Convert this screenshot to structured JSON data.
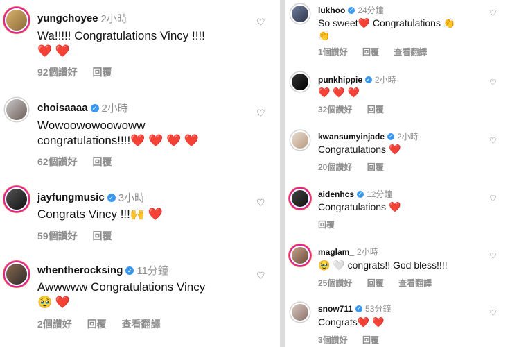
{
  "left_comments": [
    {
      "username": "yungchoyee",
      "time": "2小時",
      "lines": [
        "Wa!!!!! Congratulations Vincy !!!!",
        "❤️ ❤️"
      ],
      "likes": "92個讚好",
      "reply": "回覆",
      "translate": ""
    },
    {
      "username": "choisaaaa",
      "time": "2小時",
      "lines": [
        "Wowoowowoowoww",
        "congratulations!!!!❤️ ❤️ ❤️ ❤️"
      ],
      "likes": "62個讚好",
      "reply": "回覆",
      "translate": ""
    },
    {
      "username": "jayfungmusic",
      "time": "3小時",
      "lines": [
        "Congrats Vincy !!!🙌 ❤️"
      ],
      "likes": "59個讚好",
      "reply": "回覆",
      "translate": ""
    },
    {
      "username": "whentherocksing",
      "time": "11分鐘",
      "lines": [
        "Awwwww Congratulations Vincy",
        "🥹 ❤️"
      ],
      "likes": "2個讚好",
      "reply": "回覆",
      "translate": "查看翻譯"
    }
  ],
  "right_comments": [
    {
      "username": "lukhoo",
      "time": "24分鐘",
      "lines": [
        "So sweet❤️  Congratulations 👏",
        "👏"
      ],
      "likes": "1個讚好",
      "reply": "回覆",
      "translate": "查看翻譯"
    },
    {
      "username": "punkhippie",
      "time": "2小時",
      "lines": [
        "❤️ ❤️ ❤️"
      ],
      "likes": "32個讚好",
      "reply": "回覆",
      "translate": ""
    },
    {
      "username": "kwansumyinjade",
      "time": "2小時",
      "lines": [
        "Congratulations ❤️"
      ],
      "likes": "20個讚好",
      "reply": "回覆",
      "translate": ""
    },
    {
      "username": "aidenhcs",
      "time": "12分鐘",
      "lines": [
        "Congratulations ❤️"
      ],
      "likes": "",
      "reply": "回覆",
      "translate": ""
    },
    {
      "username": "maglam_",
      "time": "2小時",
      "lines": [
        "🥹 🤍 congrats!! God bless!!!!"
      ],
      "likes": "25個讚好",
      "reply": "回覆",
      "translate": "查看翻譯"
    },
    {
      "username": "snow711",
      "time": "53分鐘",
      "lines": [
        "Congrats❤️ ❤️"
      ],
      "likes": "3個讚好",
      "reply": "回覆",
      "translate": ""
    }
  ],
  "icons": {
    "like": "heart-outline-icon",
    "verified": "verified-badge-icon"
  },
  "colors": {
    "verified": "#3897f0",
    "meta": "#8e8e8e",
    "heart": "#e0202e",
    "story_ring": "#d6249f"
  }
}
